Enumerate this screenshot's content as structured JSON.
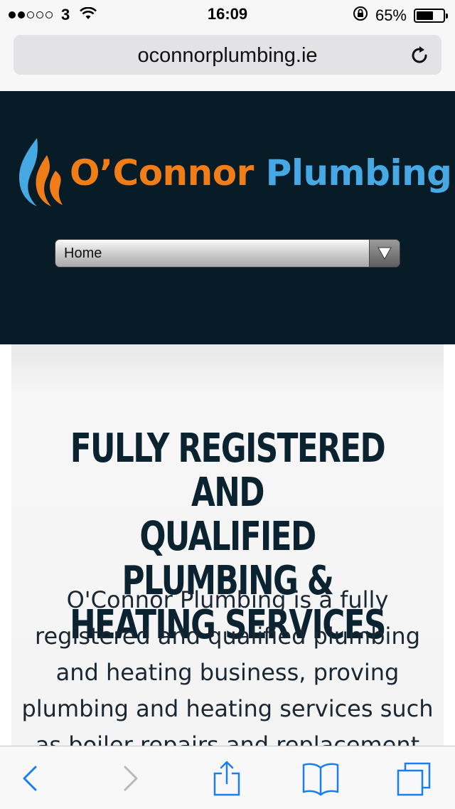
{
  "status_bar": {
    "signal_dots_filled": 2,
    "signal_dots_total": 5,
    "carrier": "3",
    "time": "16:09",
    "battery_percent": "65%",
    "battery_level": 0.65,
    "icons": [
      "wifi-icon",
      "rotation-lock-icon",
      "battery-icon"
    ]
  },
  "browser": {
    "url": "oconnorplumbing.ie",
    "reload_icon": "reload-icon"
  },
  "site": {
    "logo": {
      "word1": "O’Connor",
      "word2": "Plumbing",
      "colors": {
        "orange": "#f07d18",
        "blue": "#47a9e4"
      }
    },
    "nav_select": {
      "value": "Home"
    },
    "header_bg": "#081c28"
  },
  "hero": {
    "title_lines": [
      "FULLY REGISTERED AND",
      "QUALIFIED PLUMBING &",
      "HEATING SERVICES"
    ],
    "body_lines": [
      "O'Connor Plumbing is a fully",
      "registered and qualified plumbing",
      "and heating business, proving",
      "plumbing and heating services such",
      "as boiler repairs and replacement"
    ]
  },
  "toolbar": {
    "icons": [
      "back-icon",
      "forward-icon",
      "share-icon",
      "bookmarks-icon",
      "tabs-icon"
    ],
    "accent": "#1a7ef0"
  }
}
